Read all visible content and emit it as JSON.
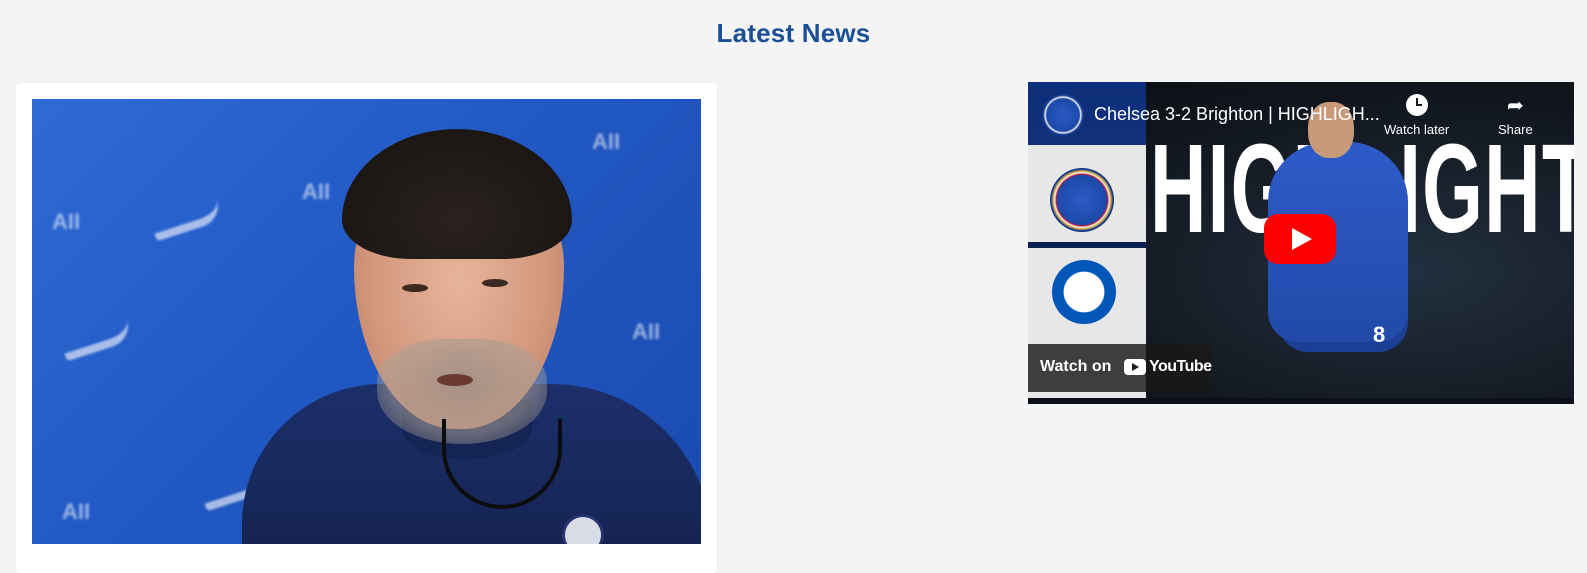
{
  "section": {
    "title": "Latest News"
  },
  "news_card": {
    "image_description_icon": "photo-press-conference"
  },
  "video": {
    "title": "Chelsea 3-2 Brighton | HIGHLIGH...",
    "thumbnail_text": "HIGHLIGHTS",
    "player_number": "8",
    "watch_later_label": "Watch later",
    "share_label": "Share",
    "watch_on_label": "Watch on",
    "youtube_label": "YouTube",
    "play_color": "#ff0000"
  },
  "colors": {
    "title": "#1a4f96",
    "background": "#f4f4f4"
  }
}
